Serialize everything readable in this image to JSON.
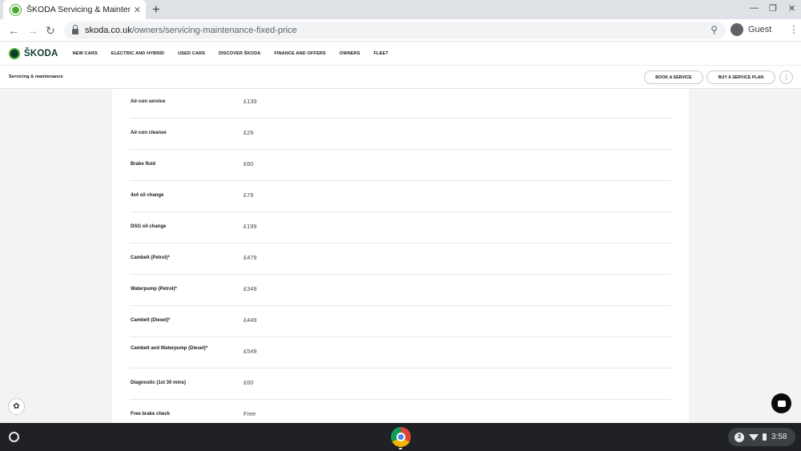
{
  "browser": {
    "tab_title": "ŠKODA Servicing & Maintenance",
    "tab_close": "✕",
    "new_tab": "+",
    "url_host": "skoda.co.uk",
    "url_path": "/owners/servicing-maintenance-fixed-price",
    "profile": "Guest"
  },
  "site": {
    "logo": "ŠKODA",
    "nav": [
      "NEW CARS",
      "ELECTRIC AND HYBRID",
      "USED CARS",
      "DISCOVER ŠKODA",
      "FINANCE AND OFFERS",
      "OWNERS",
      "FLEET"
    ]
  },
  "subheader": {
    "title": "Servicing & maintenance",
    "book_label": "BOOK A SERVICE",
    "buy_label": "BUY A SERVICE PLAN"
  },
  "prices": [
    {
      "name": "Air-con service",
      "price": "£139"
    },
    {
      "name": "Air-con cleanse",
      "price": "£29"
    },
    {
      "name": "Brake fluid",
      "price": "£60"
    },
    {
      "name": "4x4 oil change",
      "price": "£79"
    },
    {
      "name": "DSG oil change",
      "price": "£199"
    },
    {
      "name": "Cambelt (Petrol)*",
      "price": "£479"
    },
    {
      "name": "Waterpump (Petrol)*",
      "price": "£349"
    },
    {
      "name": "Cambelt (Diesel)*",
      "price": "£449"
    },
    {
      "name": "Cambelt and Waterpump (Diesel)*",
      "price": "£549"
    },
    {
      "name": "Diagnostic (1st 30 mins)",
      "price": "£60"
    },
    {
      "name": "Free brake check",
      "price": "Free"
    }
  ],
  "shelf": {
    "notification_count": "3",
    "time": "3:58"
  },
  "colors": {
    "brand_green": "#4ba82e",
    "brand_dark": "#0e3a2f"
  }
}
